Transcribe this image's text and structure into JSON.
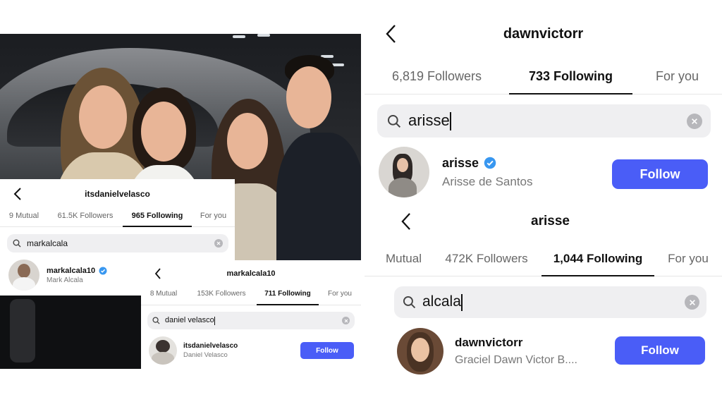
{
  "colors": {
    "follow_blue": "#4a5df7",
    "verified_blue": "#3897f0",
    "search_bg": "#efeff1"
  },
  "icons": {
    "back": "chevron-left-icon",
    "search": "search-icon",
    "clear": "clear-icon",
    "verified": "verified-badge-icon"
  },
  "panel_a": {
    "title": "itsdanielvelasco",
    "tabs": [
      "9 Mutual",
      "61.5K Followers",
      "965 Following",
      "For you"
    ],
    "active_tab": 2,
    "search_value": "markalcala",
    "result": {
      "username": "markalcala10",
      "full_name": "Mark Alcala"
    }
  },
  "panel_b": {
    "title": "markalcala10",
    "tabs": [
      "8 Mutual",
      "153K Followers",
      "711 Following",
      "For you"
    ],
    "active_tab": 2,
    "search_value": "daniel velasco",
    "result": {
      "username": "itsdanielvelasco",
      "full_name": "Daniel Velasco",
      "follow_label": "Follow"
    }
  },
  "panel_c": {
    "title": "dawnvictorr",
    "tabs": [
      "6,819 Followers",
      "733 Following",
      "For you"
    ],
    "active_tab": 1,
    "search_value": "arisse",
    "result": {
      "username": "arisse",
      "full_name": "Arisse de Santos",
      "follow_label": "Follow"
    }
  },
  "panel_d": {
    "title": "arisse",
    "tabs": [
      "Mutual",
      "472K Followers",
      "1,044 Following",
      "For you"
    ],
    "active_tab": 2,
    "search_value": "alcala",
    "result": {
      "username": "dawnvictorr",
      "full_name": "Graciel Dawn Victor B....",
      "follow_label": "Follow"
    }
  }
}
